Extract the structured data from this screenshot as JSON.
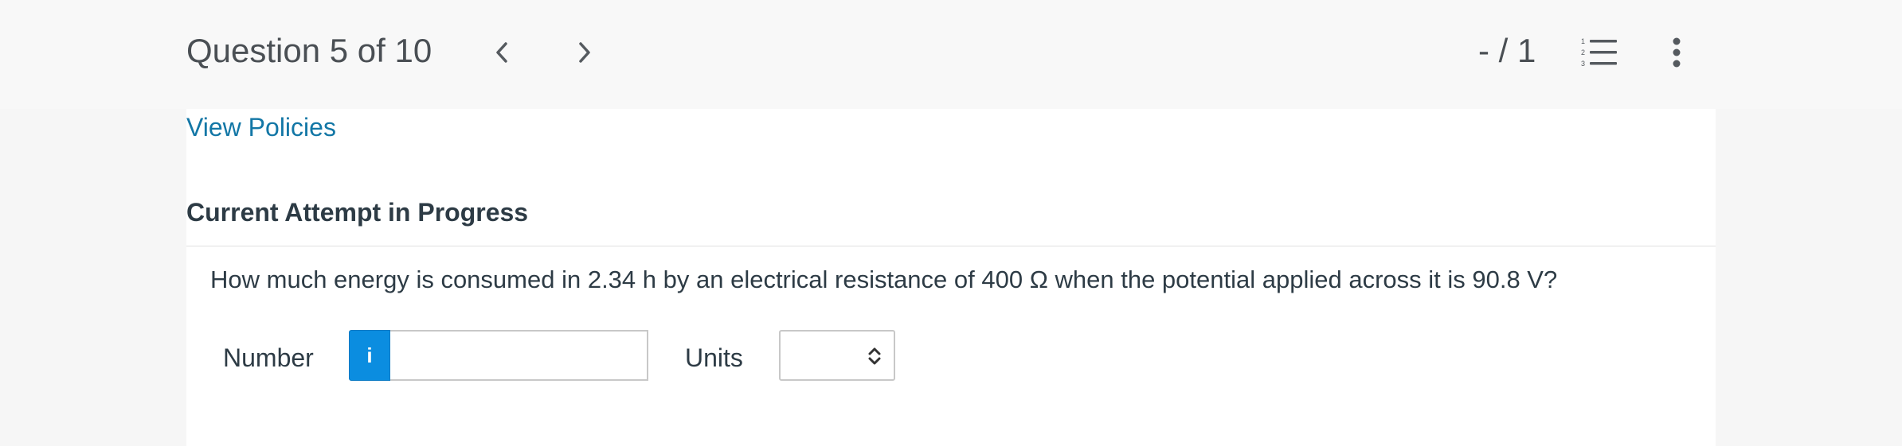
{
  "header": {
    "question_title": "Question 5 of 10",
    "score": "- / 1",
    "prev_icon": "chevron-left-icon",
    "next_icon": "chevron-right-icon",
    "list_icon": "numbered-list-icon",
    "more_icon": "more-vertical-icon"
  },
  "main": {
    "policies_link": "View Policies",
    "attempt_heading": "Current Attempt in Progress",
    "question_text": "How much energy is consumed in 2.34 h by an electrical resistance of 400 Ω when the potential applied across it is 90.8 V?",
    "number_label": "Number",
    "number_value": "",
    "info_icon": "info-icon",
    "info_glyph": "i",
    "units_label": "Units",
    "units_selected": ""
  },
  "colors": {
    "link": "#1377a6",
    "info_button": "#0b8de0"
  }
}
